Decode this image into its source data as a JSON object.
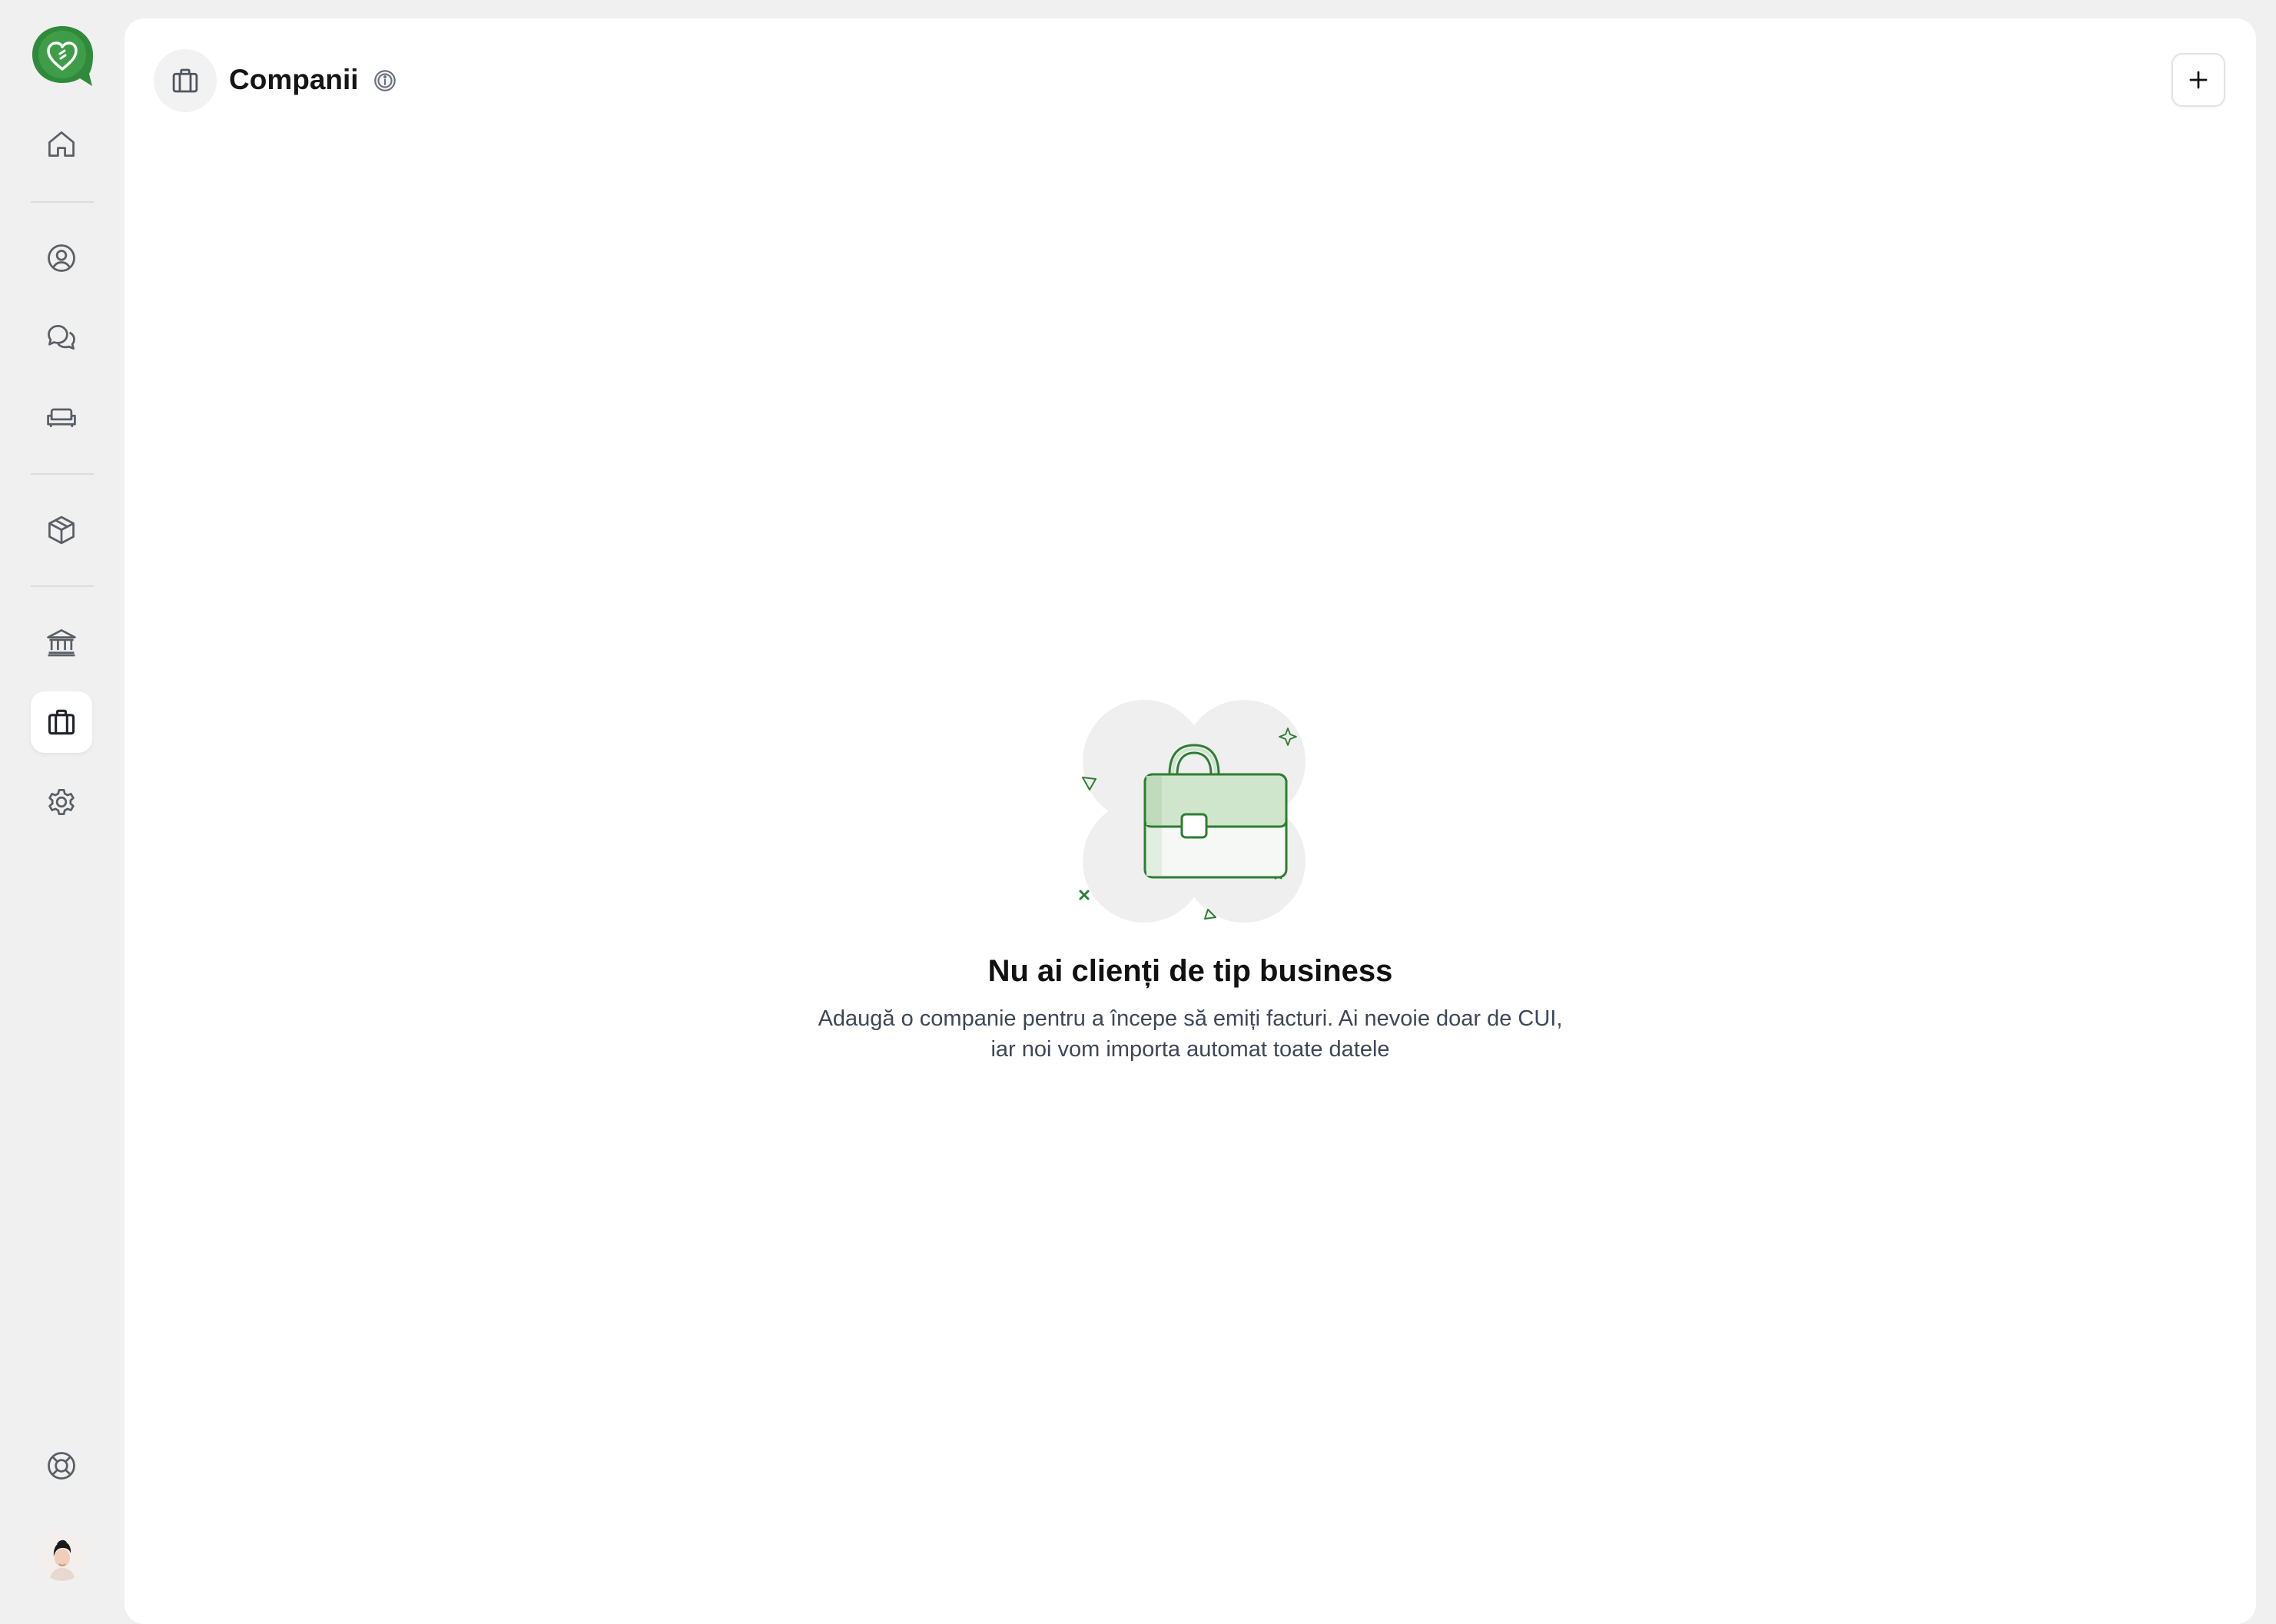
{
  "brand": {
    "accent": "#2e8b3a",
    "accent_light": "#cfe6cc"
  },
  "sidebar": {
    "items": [
      {
        "name": "home",
        "icon": "home-icon",
        "active": false
      },
      {
        "name": "contacts",
        "icon": "user-circle-icon",
        "active": false
      },
      {
        "name": "messages",
        "icon": "chat-bubbles-icon",
        "active": false
      },
      {
        "name": "accommodation",
        "icon": "sofa-icon",
        "active": false
      },
      {
        "name": "products",
        "icon": "box-icon",
        "active": false
      },
      {
        "name": "bank",
        "icon": "bank-icon",
        "active": false
      },
      {
        "name": "companies",
        "icon": "briefcase-icon",
        "active": true
      },
      {
        "name": "settings",
        "icon": "gear-icon",
        "active": false
      },
      {
        "name": "help",
        "icon": "lifebuoy-icon",
        "active": false
      }
    ],
    "profile": {
      "icon": "avatar"
    }
  },
  "header": {
    "title": "Companii",
    "icon": "briefcase-icon",
    "info_icon": "info-icon",
    "add_icon": "plus-icon"
  },
  "empty_state": {
    "illustration": "briefcase-illustration",
    "title": "Nu ai clienți de tip business",
    "description_line1": "Adaugă o companie pentru a începe să emiți facturi. Ai nevoie doar de CUI,",
    "description_line2": "iar noi vom importa automat toate datele"
  }
}
